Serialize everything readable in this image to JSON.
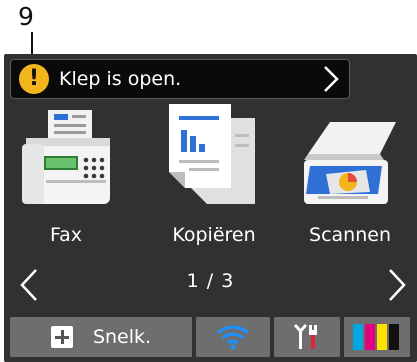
{
  "callout": {
    "number": "9"
  },
  "alert": {
    "message": "Klep is open.",
    "icon": "warning-icon",
    "icon_color": "#f2b51c"
  },
  "functions": [
    {
      "label": "Fax",
      "icon": "fax-icon"
    },
    {
      "label": "Kopiëren",
      "icon": "copy-icon"
    },
    {
      "label": "Scannen",
      "icon": "scanner-icon"
    }
  ],
  "pager": {
    "page_indicator": "1 / 3"
  },
  "bottom_bar": {
    "shortcut_label": "Snelk.",
    "wifi_icon": "wifi-icon",
    "settings_icon": "settings-icon",
    "ink_icon": "ink-icon",
    "ink_colors": [
      "#00a7e1",
      "#e6007e",
      "#ffe100",
      "#111111"
    ],
    "accent": "#1e90ff"
  }
}
